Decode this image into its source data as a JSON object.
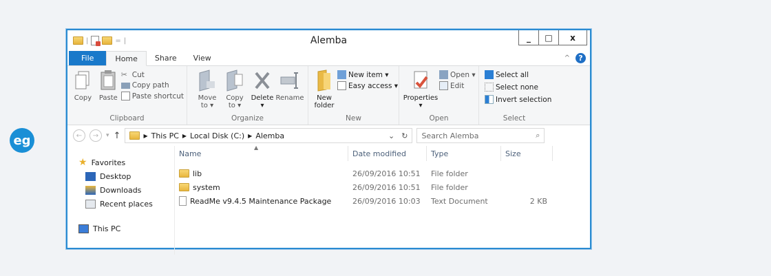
{
  "logo": {
    "text": "eg"
  },
  "window": {
    "title": "Alemba",
    "qat_sep": "=",
    "controls": {
      "minimize": "_",
      "maximize": "□",
      "close": "x"
    }
  },
  "tabs": [
    {
      "label": "File"
    },
    {
      "label": "Home"
    },
    {
      "label": "Share"
    },
    {
      "label": "View"
    }
  ],
  "ribbon": {
    "clipboard": {
      "label": "Clipboard",
      "copy": "Copy",
      "paste": "Paste",
      "cut": "Cut",
      "copy_path": "Copy path",
      "paste_shortcut": "Paste shortcut"
    },
    "organize": {
      "label": "Organize",
      "move_to": "Move to ▾",
      "copy_to": "Copy to ▾",
      "delete": "Delete ▾",
      "rename": "Rename"
    },
    "new": {
      "label": "New",
      "new_folder": "New folder",
      "new_item": "New item ▾",
      "easy_access": "Easy access ▾"
    },
    "open": {
      "label": "Open",
      "properties": "Properties ▾",
      "open": "Open ▾",
      "edit": "Edit"
    },
    "select": {
      "label": "Select",
      "select_all": "Select all",
      "select_none": "Select none",
      "invert": "Invert selection"
    }
  },
  "address": {
    "parts": [
      "This PC",
      "Local Disk (C:)",
      "Alemba"
    ],
    "search_placeholder": "Search Alemba"
  },
  "nav": {
    "favorites": "Favorites",
    "items": [
      {
        "label": "Desktop"
      },
      {
        "label": "Downloads"
      },
      {
        "label": "Recent places"
      }
    ],
    "this_pc": "This PC"
  },
  "columns": {
    "name": "Name",
    "date": "Date modified",
    "type": "Type",
    "size": "Size"
  },
  "files": [
    {
      "name": "lib",
      "date": "26/09/2016 10:51",
      "type": "File folder",
      "size": ""
    },
    {
      "name": "system",
      "date": "26/09/2016 10:51",
      "type": "File folder",
      "size": ""
    },
    {
      "name": "ReadMe v9.4.5 Maintenance Package",
      "date": "26/09/2016 10:03",
      "type": "Text Document",
      "size": "2 KB"
    }
  ]
}
